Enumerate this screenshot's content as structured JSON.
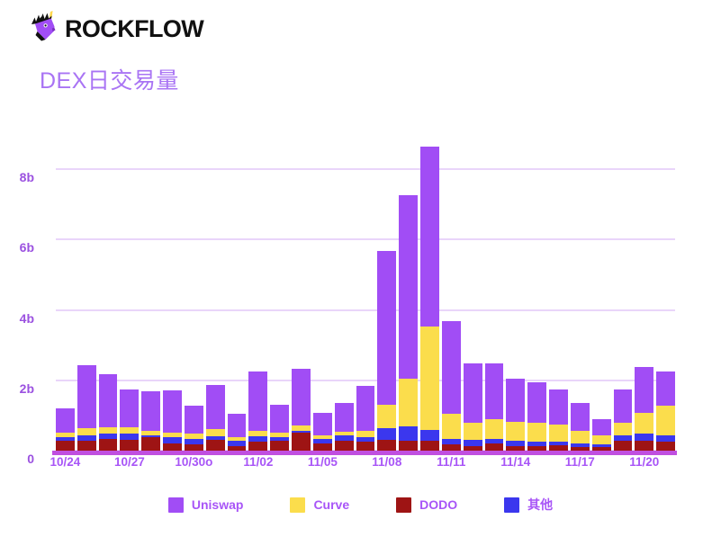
{
  "brand": {
    "name": "ROCKFLOW",
    "logo_icon": "unicorn-head-icon",
    "logo_color": "#A14DF5"
  },
  "chart_title": "DEX日交易量",
  "colors": {
    "uniswap": "#A14DF5",
    "curve": "#FBDD4C",
    "dodo": "#9E1414",
    "other": "#3B37EE",
    "grid": "#E9D5FA",
    "axis": "#C04FE0",
    "label": "#A855F7",
    "title": "#A974F4",
    "background": "#FFFFFF"
  },
  "chart_data": {
    "type": "bar",
    "stacked": true,
    "title": "DEX日交易量",
    "xlabel": "",
    "ylabel": "",
    "ylim": [
      0,
      9
    ],
    "yticks": [
      0,
      2,
      4,
      6,
      8
    ],
    "ytick_labels": [
      "0",
      "2b",
      "4b",
      "6b",
      "8b"
    ],
    "grid": true,
    "legend_position": "bottom",
    "unit": "b",
    "categories": [
      "10/24",
      "10/25",
      "10/26",
      "10/27",
      "10/28",
      "10/29",
      "10/30o",
      "10/31",
      "11/01",
      "11/02",
      "11/03",
      "11/04",
      "11/05",
      "11/06",
      "11/07",
      "11/08",
      "11/09",
      "11/10",
      "11/11",
      "11/12",
      "11/13",
      "11/14",
      "11/15",
      "11/16",
      "11/17",
      "11/18",
      "11/19",
      "11/20",
      "11/21"
    ],
    "xtick_labels": [
      "10/24",
      "10/27",
      "10/30o",
      "11/02",
      "11/05",
      "11/08",
      "11/11",
      "11/14",
      "11/17",
      "11/20"
    ],
    "xtick_indices": [
      0,
      3,
      6,
      9,
      12,
      15,
      18,
      21,
      24,
      27
    ],
    "series": [
      {
        "name": "DODO",
        "color": "#9E1414",
        "values": [
          0.3,
          0.32,
          0.35,
          0.34,
          0.42,
          0.22,
          0.2,
          0.33,
          0.16,
          0.28,
          0.3,
          0.53,
          0.24,
          0.32,
          0.28,
          0.34,
          0.3,
          0.32,
          0.2,
          0.15,
          0.22,
          0.15,
          0.15,
          0.18,
          0.14,
          0.13,
          0.32,
          0.3,
          0.28
        ]
      },
      {
        "name": "其他",
        "color": "#3B37EE",
        "values": [
          0.1,
          0.14,
          0.15,
          0.16,
          0.05,
          0.18,
          0.16,
          0.1,
          0.14,
          0.16,
          0.12,
          0.07,
          0.12,
          0.13,
          0.14,
          0.33,
          0.42,
          0.3,
          0.15,
          0.18,
          0.13,
          0.15,
          0.14,
          0.09,
          0.1,
          0.08,
          0.13,
          0.2,
          0.17
        ]
      },
      {
        "name": "Curve",
        "color": "#FBDD4C",
        "values": [
          0.14,
          0.2,
          0.18,
          0.2,
          0.12,
          0.13,
          0.14,
          0.22,
          0.1,
          0.16,
          0.12,
          0.13,
          0.1,
          0.12,
          0.17,
          0.67,
          1.36,
          2.93,
          0.72,
          0.5,
          0.58,
          0.55,
          0.52,
          0.5,
          0.36,
          0.24,
          0.36,
          0.6,
          0.86
        ]
      },
      {
        "name": "Uniswap",
        "color": "#A14DF5",
        "values": [
          0.7,
          1.8,
          1.52,
          1.07,
          1.13,
          1.2,
          0.8,
          1.24,
          0.67,
          1.67,
          0.8,
          1.62,
          0.65,
          0.8,
          1.27,
          4.35,
          5.22,
          5.12,
          2.63,
          1.67,
          1.58,
          1.23,
          1.15,
          1.0,
          0.78,
          0.47,
          0.95,
          1.3,
          0.96
        ]
      }
    ]
  },
  "legend": [
    {
      "label": "Uniswap",
      "color": "#A14DF5"
    },
    {
      "label": "Curve",
      "color": "#FBDD4C"
    },
    {
      "label": "DODO",
      "color": "#9E1414"
    },
    {
      "label": "其他",
      "color": "#3B37EE"
    }
  ]
}
